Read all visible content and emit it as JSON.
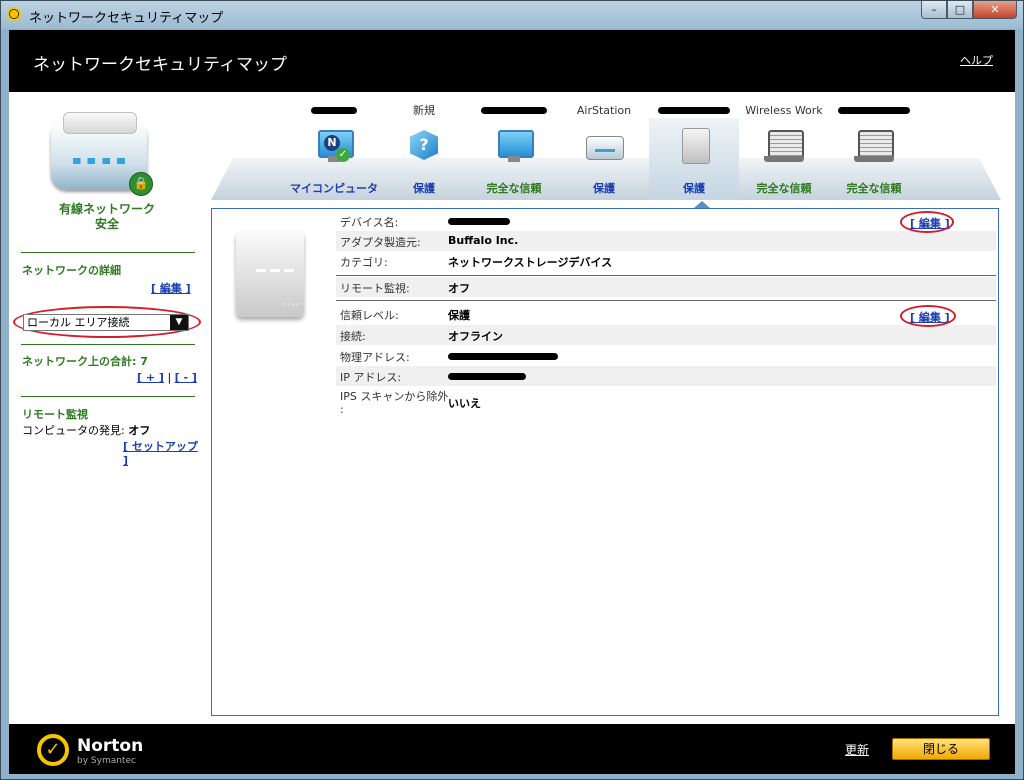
{
  "window": {
    "title": "ネットワークセキュリティマップ",
    "minimize": "–",
    "maximize": "□",
    "close": "✕"
  },
  "header": {
    "title": "ネットワークセキュリティマップ",
    "help": "ヘルプ"
  },
  "sidebar": {
    "network_status_line1": "有線ネットワーク",
    "network_status_line2": "安全",
    "details_title": "ネットワークの詳細",
    "edit_link": "[ 編集 ]",
    "connection_select": "ローカル エリア接続",
    "total_label": "ネットワーク上の合計: 7",
    "plus_link": "[ + ]",
    "separator": "|",
    "minus_link": "[ - ]",
    "remote_title": "リモート監視",
    "computer_discovery_label": "コンピュータの発見:",
    "computer_discovery_value": "オフ",
    "setup_link": "[ セットアップ ]"
  },
  "devices": [
    {
      "top": "",
      "label": "マイコンピュータ",
      "icon": "my-computer-icon"
    },
    {
      "top": "新規",
      "label": "保護",
      "icon": "unknown-device-icon"
    },
    {
      "top": "",
      "label": "完全な信頼",
      "icon": "monitor-icon"
    },
    {
      "top": "AirStation",
      "label": "保護",
      "icon": "router-icon"
    },
    {
      "top": "",
      "label": "保護",
      "icon": "nas-icon",
      "selected": true
    },
    {
      "top": "Wireless Work",
      "label": "完全な信頼",
      "icon": "laptop-icon"
    },
    {
      "top": "",
      "label": "完全な信頼",
      "icon": "laptop-icon"
    }
  ],
  "details": {
    "device_name_label": "デバイス名:",
    "vendor_label": "アダプタ製造元:",
    "vendor_value": "Buffalo Inc.",
    "category_label": "カテゴリ:",
    "category_value": "ネットワークストレージデバイス",
    "remote_label": "リモート監視:",
    "remote_value": "オフ",
    "trust_label": "信頼レベル:",
    "trust_value": "保護",
    "connection_label": "接続:",
    "connection_value": "オフライン",
    "mac_label": "物理アドレス:",
    "ip_label": "IP アドレス:",
    "ips_label_line1": "IPS スキャンから除外",
    "ips_label_line2": ":",
    "ips_value": "いいえ",
    "edit_link": "[ 編集 ]"
  },
  "footer": {
    "brand": "Norton",
    "by": "by Symantec",
    "refresh": "更新",
    "close": "閉じる"
  }
}
